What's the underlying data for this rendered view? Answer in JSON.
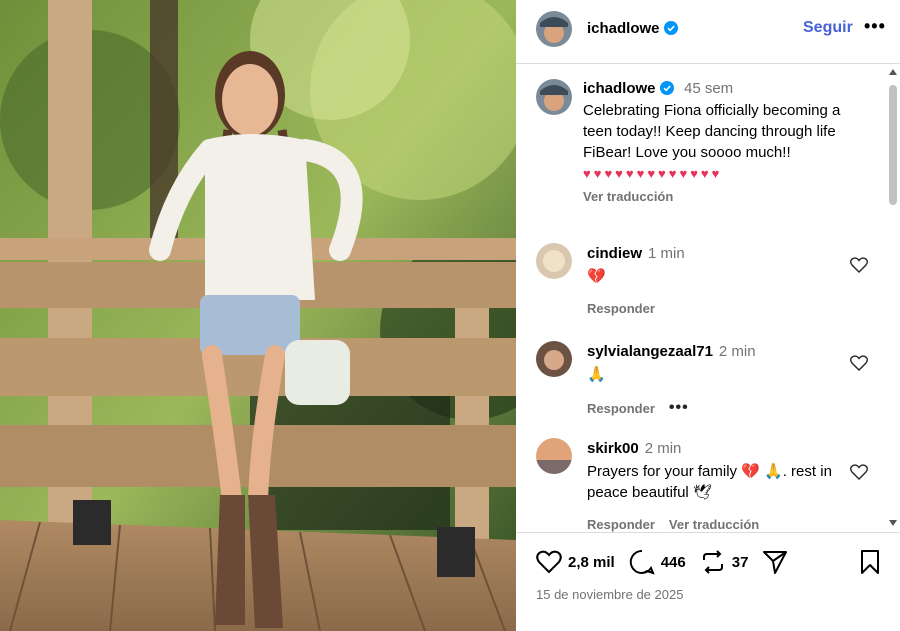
{
  "post": {
    "username": "ichadlowe",
    "follow_label": "Seguir",
    "more_label": "•••",
    "date": "15 de noviembre de 2025"
  },
  "caption": {
    "username": "ichadlowe",
    "time": "45 sem",
    "text": "Celebrating Fiona officially becoming a teen today!! Keep dancing through life FiBear! Love you soooo much!!",
    "hearts": "♥♥♥♥♥♥♥♥♥♥♥♥♥",
    "translate_label": "Ver traducción"
  },
  "comments": [
    {
      "username": "cindiew",
      "time": "1 min",
      "text": "💔",
      "reply_label": "Responder",
      "avatar_color": "#d9c7b0"
    },
    {
      "username": "sylvialangezaal71",
      "time": "2 min",
      "text": "🙏",
      "reply_label": "Responder",
      "more_label": "•••",
      "avatar_color": "#6b5242"
    },
    {
      "username": "skirk00",
      "time": "2 min",
      "text": "Prayers for your family 💔 🙏. rest in peace beautiful 🕊",
      "reply_label": "Responder",
      "translate_label": "Ver traducción",
      "avatar_color": "#e1a47a"
    }
  ],
  "actions": {
    "likes": "2,8 mil",
    "comments": "446",
    "reposts": "37"
  },
  "icons": [
    "verified-badge-icon",
    "heart-icon",
    "comment-icon",
    "repost-icon",
    "share-icon",
    "bookmark-icon",
    "more-icon"
  ],
  "colors": {
    "link": "#4762d6",
    "muted": "#737373",
    "verified": "#0095f6",
    "heart": "#e8305a"
  }
}
